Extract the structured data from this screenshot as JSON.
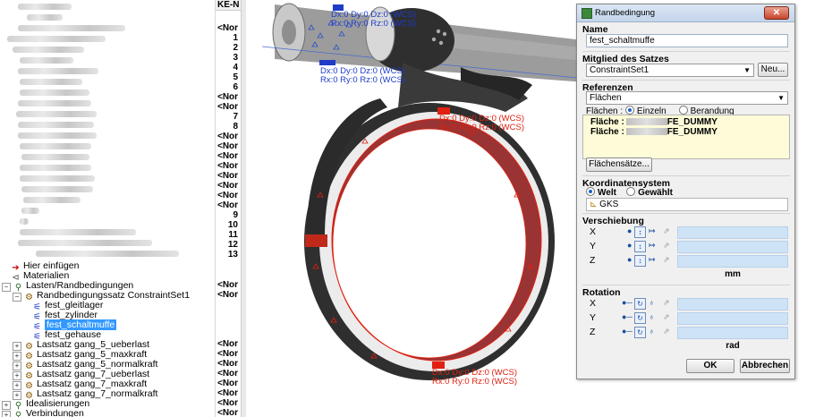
{
  "tree": {
    "items": [
      {
        "label": "Hier einfügen",
        "icon": "arrow-right-icon"
      },
      {
        "label": "Materialien",
        "icon": "material-icon"
      },
      {
        "label": "Lasten/Randbedingungen",
        "icon": "loads-folder-icon"
      },
      {
        "label": "Randbedingungssatz ConstraintSet1",
        "icon": "constraint-set-icon"
      },
      {
        "label": "fest_gleitlager",
        "icon": "constraint-icon"
      },
      {
        "label": "fest_zylinder",
        "icon": "constraint-icon"
      },
      {
        "label": "fest_schaltmuffe",
        "icon": "constraint-icon"
      },
      {
        "label": "fest_gehause",
        "icon": "constraint-icon"
      },
      {
        "label": "Lastsatz gang_5_ueberlast",
        "icon": "load-set-icon"
      },
      {
        "label": "Lastsatz gang_5_maxkraft",
        "icon": "load-set-icon"
      },
      {
        "label": "Lastsatz gang_5_normalkraft",
        "icon": "load-set-icon"
      },
      {
        "label": "Lastsatz gang_7_ueberlast",
        "icon": "load-set-icon"
      },
      {
        "label": "Lastsatz gang_7_maxkraft",
        "icon": "load-set-icon"
      },
      {
        "label": "Lastsatz gang_7_normalkraft",
        "icon": "load-set-icon"
      },
      {
        "label": "Idealisierungen",
        "icon": "idealization-icon"
      },
      {
        "label": "Verbindungen",
        "icon": "connection-icon"
      }
    ],
    "selected": "fest_schaltmuffe"
  },
  "columns": {
    "header": "KE-N",
    "values": [
      "<Nor",
      "1",
      "2",
      "3",
      "4",
      "5",
      "6",
      "<Nor",
      "<Nor",
      "7",
      "8",
      "<Nor",
      "<Nor",
      "<Nor",
      "<Nor",
      "<Nor",
      "<Nor",
      "<Nor",
      "<Nor",
      "9",
      "10",
      "11",
      "12",
      "13",
      "<Nor",
      "<Nor",
      "<Nor",
      "<Nor",
      "<Nor",
      "<Nor",
      "<Nor",
      "<Nor",
      "<Nor",
      "<Nor"
    ]
  },
  "viewport": {
    "labels": [
      {
        "line1": "Dx:0 Dy:0 Dz:0 (WCS)",
        "line2": "Rx:0 Ry:0 Rz:0 (WCS)",
        "color": "#1e3cc8"
      },
      {
        "line1": "Dx:0 Dy:0 Dz:0 (WCS)",
        "line2": "Rx:0 Ry:0 Rz:0 (WCS)",
        "color": "#1e3cc8"
      },
      {
        "line1": "Dx:0 Dy:0 Dz:0 (WCS)",
        "line2": "Rx:0 Ry:0 Rz:0 (WCS)",
        "color": "#e02010"
      },
      {
        "line1": "Dx:0 Dy:0 Dz:0 (WCS)",
        "line2": "Rx:0 Ry:0 Rz:0 (WCS)",
        "color": "#e02010"
      }
    ]
  },
  "dialog": {
    "title": "Randbedingung",
    "close": "✕",
    "name_label": "Name",
    "name_value": "fest_schaltmuffe",
    "member_label": "Mitglied des Satzes",
    "member_value": "ConstraintSet1",
    "new_button": "Neu...",
    "references_label": "Referenzen",
    "references_value": "Flächen",
    "faces_prefix": "Flächen :",
    "radio_single": "Einzeln",
    "radio_boundary": "Berandung",
    "face_items": [
      {
        "prefix": "Fläche :",
        "suffix": "FE_DUMMY"
      },
      {
        "prefix": "Fläche :",
        "suffix": "FE_DUMMY"
      }
    ],
    "facesets_button": "Flächensätze...",
    "coord_label": "Koordinatensystem",
    "coord_world": "Welt",
    "coord_selected": "Gewählt",
    "coord_value": "GKS",
    "translation_label": "Verschiebung",
    "rotation_label": "Rotation",
    "axes": [
      "X",
      "Y",
      "Z"
    ],
    "translation_unit": "mm",
    "rotation_unit": "rad",
    "ok_button": "OK",
    "cancel_button": "Abbrechen"
  },
  "colors": {
    "selection": "#3399ff",
    "constraint_blue": "#1e3cc8",
    "constraint_red": "#e02010",
    "inner_surface": "#a83a3a"
  }
}
